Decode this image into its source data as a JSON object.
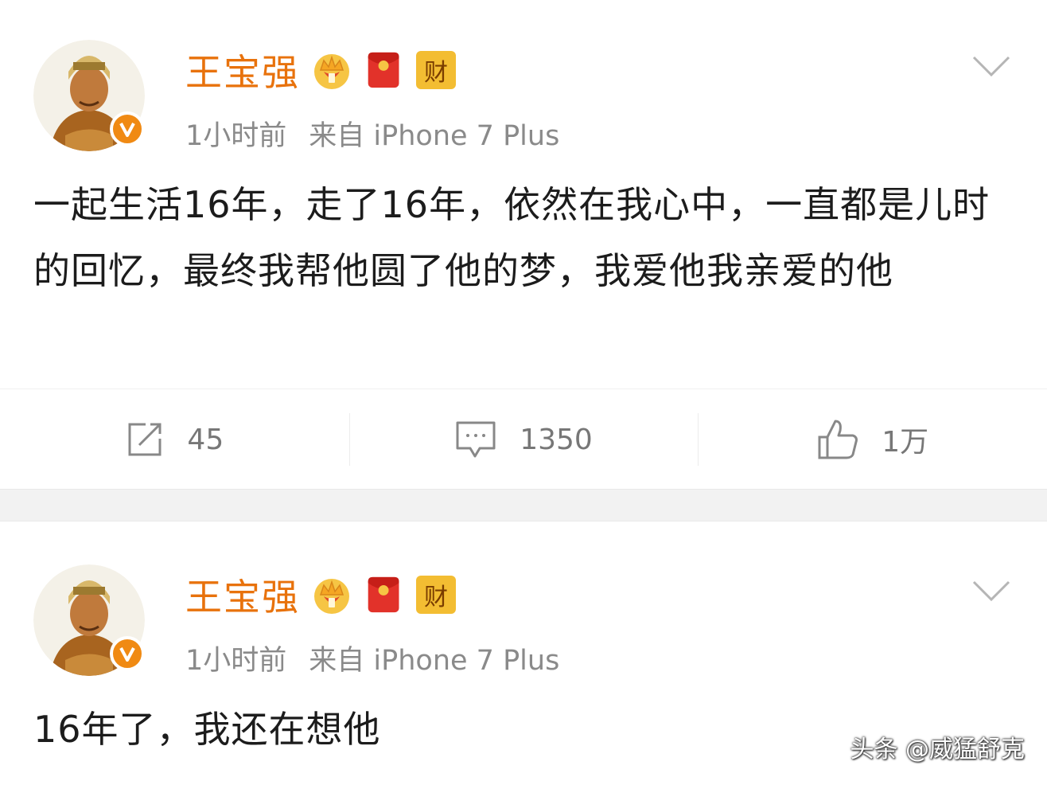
{
  "accent": "#e8720c",
  "posts": [
    {
      "user": {
        "name": "王宝强",
        "badges": [
          "crown-badge-icon",
          "red-envelope-icon",
          "财"
        ],
        "verified_mark": "V"
      },
      "meta": {
        "time": "1小时前",
        "source": "来自 iPhone 7 Plus"
      },
      "content": "一起生活16年，走了16年，依然在我心中，一直都是儿时的回忆，最终我帮他圆了他的梦，我爱他我亲爱的他",
      "actions": {
        "repost": "45",
        "comment": "1350",
        "like": "1万"
      }
    },
    {
      "user": {
        "name": "王宝强",
        "badges": [
          "crown-badge-icon",
          "red-envelope-icon",
          "财"
        ],
        "verified_mark": "V"
      },
      "meta": {
        "time": "1小时前",
        "source": "来自 iPhone 7 Plus"
      },
      "content": "16年了，我还在想他"
    }
  ],
  "watermark": "头条 @威猛舒克"
}
